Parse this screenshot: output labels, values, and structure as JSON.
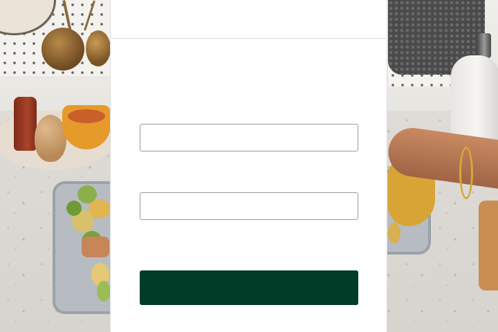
{
  "modal": {
    "header_title": "",
    "fields": [
      {
        "value": "",
        "placeholder": ""
      },
      {
        "value": "",
        "placeholder": ""
      }
    ],
    "submit_label": ""
  },
  "colors": {
    "submit_button": "#003d29",
    "panel_background": "#ffffff",
    "field_border": "#9a9a9a"
  }
}
